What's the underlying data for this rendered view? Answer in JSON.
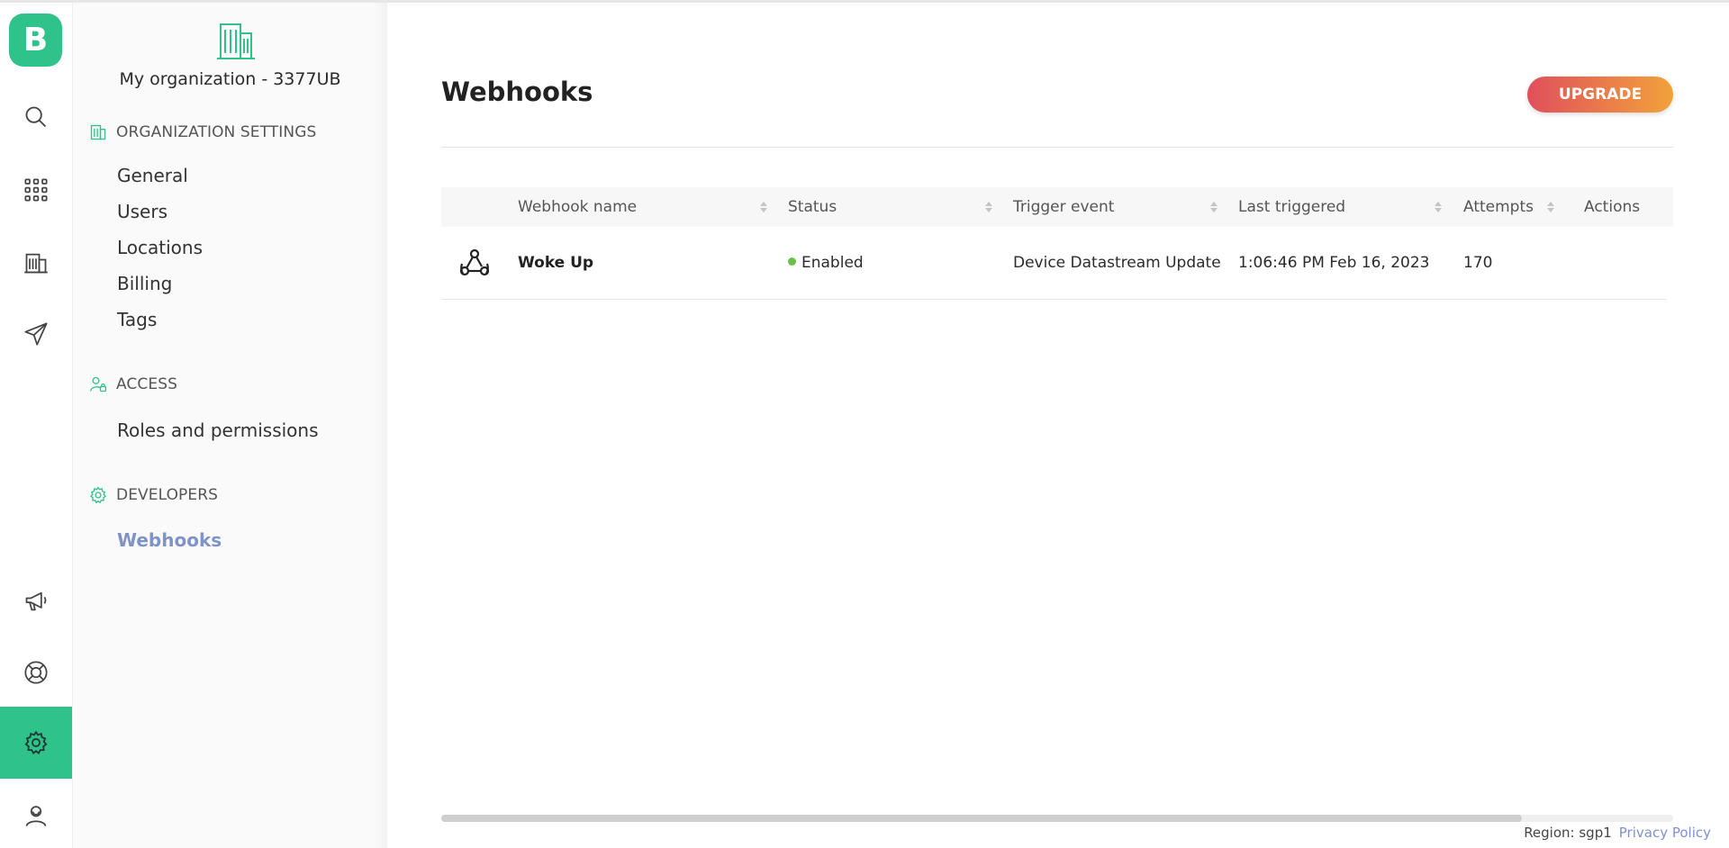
{
  "app": {
    "logo_letter": "B",
    "accent": "#2fc28a"
  },
  "rail": {
    "icons": [
      "search-icon",
      "apps-grid-icon",
      "building-icon",
      "send-icon",
      "megaphone-icon",
      "lifebuoy-icon",
      "gear-icon",
      "user-icon"
    ],
    "active": "gear-icon"
  },
  "sidebar": {
    "org_name": "My organization - 3377UB",
    "sections": [
      {
        "title": "ORGANIZATION SETTINGS",
        "items": [
          "General",
          "Users",
          "Locations",
          "Billing",
          "Tags"
        ]
      },
      {
        "title": "ACCESS",
        "items": [
          "Roles and permissions"
        ]
      },
      {
        "title": "DEVELOPERS",
        "items": [
          "Webhooks"
        ]
      }
    ],
    "active_item": "Webhooks"
  },
  "main": {
    "title": "Webhooks",
    "upgrade_label": "UPGRADE",
    "table": {
      "columns": [
        "Webhook name",
        "Status",
        "Trigger event",
        "Last triggered",
        "Attempts",
        "Actions"
      ],
      "rows": [
        {
          "name": "Woke Up",
          "status": "Enabled",
          "trigger": "Device Datastream Update",
          "last_triggered": "1:06:46 PM Feb 16, 2023",
          "attempts": "170"
        }
      ]
    }
  },
  "footer": {
    "region": "Region: sgp1",
    "privacy": "Privacy Policy"
  },
  "colors": {
    "enabled_dot": "#6cc04a",
    "link": "#7f93c9",
    "upgrade_start": "#e0505c",
    "upgrade_end": "#f2a23a"
  }
}
